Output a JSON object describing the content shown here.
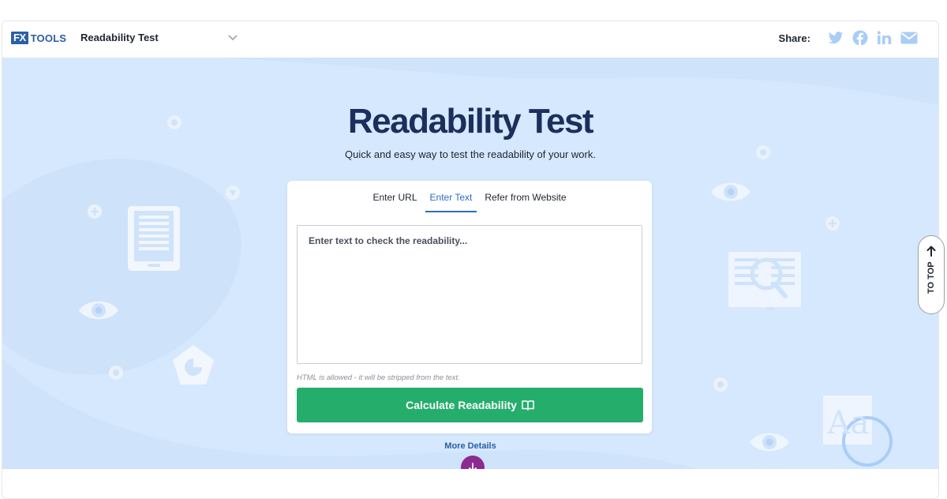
{
  "header": {
    "logo_mark": "FX",
    "logo_text": "TOOLS",
    "tool_title": "Readability Test",
    "share_label": "Share:",
    "share_icons": [
      "twitter-icon",
      "facebook-icon",
      "linkedin-icon",
      "email-icon"
    ]
  },
  "hero": {
    "title": "Readability Test",
    "subtitle": "Quick and easy way to test the readability of your work."
  },
  "tabs": [
    {
      "label": "Enter URL",
      "active": false
    },
    {
      "label": "Enter Text",
      "active": true
    },
    {
      "label": "Refer from Website",
      "active": false
    }
  ],
  "editor": {
    "placeholder": "Enter text to check the readability...",
    "value": "",
    "hint": "HTML is allowed - it will be stripped from the text."
  },
  "calculate_button": {
    "label": "Calculate Readability",
    "icon": "book-open-icon"
  },
  "more_details": {
    "label": "More Details",
    "icon": "arrow-down-icon"
  },
  "to_top": {
    "label": "TO TOP",
    "icon": "arrow-up-icon"
  },
  "colors": {
    "brand_blue": "#2b5ea7",
    "hero_bg": "#cfe3fb",
    "title_navy": "#1c2f5c",
    "button_green": "#25ae6b",
    "more_purple": "#8b2a91",
    "share_icon": "#a9cdf6"
  }
}
